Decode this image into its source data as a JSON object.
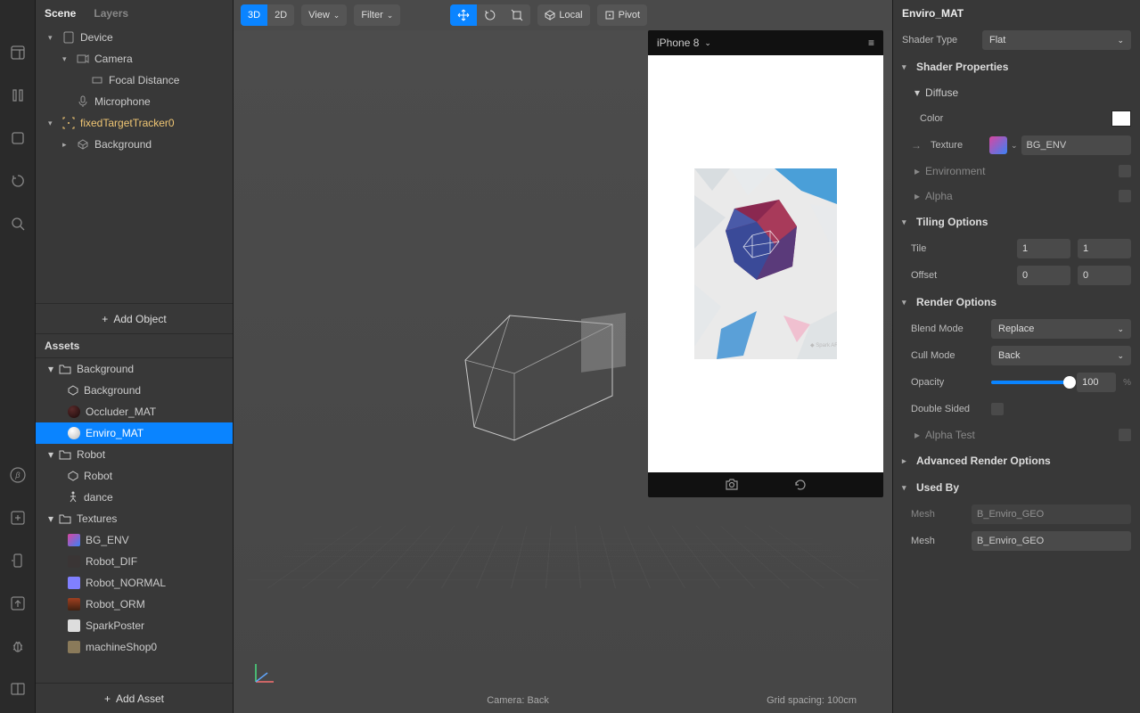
{
  "leftPanel": {
    "tabs": {
      "scene": "Scene",
      "layers": "Layers"
    },
    "scene": {
      "device": "Device",
      "camera": "Camera",
      "focalDistance": "Focal Distance",
      "microphone": "Microphone",
      "tracker": "fixedTargetTracker0",
      "background": "Background"
    },
    "addObject": "Add Object",
    "assetsHeader": "Assets",
    "assets": {
      "bgFolder": "Background",
      "bgMesh": "Background",
      "occluder": "Occluder_MAT",
      "enviro": "Enviro_MAT",
      "robotFolder": "Robot",
      "robotMesh": "Robot",
      "dance": "dance",
      "texFolder": "Textures",
      "bgEnv": "BG_ENV",
      "robotDif": "Robot_DIF",
      "robotNormal": "Robot_NORMAL",
      "robotOrm": "Robot_ORM",
      "sparkPoster": "SparkPoster",
      "machineShop": "machineShop0"
    },
    "addAsset": "Add Asset"
  },
  "toolbar": {
    "mode3d": "3D",
    "mode2d": "2D",
    "view": "View",
    "filter": "Filter",
    "local": "Local",
    "pivot": "Pivot"
  },
  "devicePreview": {
    "name": "iPhone 8"
  },
  "statusBar": {
    "camera": "Camera: Back",
    "grid": "Grid spacing: 100cm"
  },
  "inspector": {
    "title": "Enviro_MAT",
    "shaderTypeLabel": "Shader Type",
    "shaderType": "Flat",
    "shaderProperties": "Shader Properties",
    "diffuse": "Diffuse",
    "colorLabel": "Color",
    "textureLabel": "Texture",
    "textureName": "BG_ENV",
    "environment": "Environment",
    "alpha": "Alpha",
    "tilingOptions": "Tiling Options",
    "tileLabel": "Tile",
    "tileX": "1",
    "tileY": "1",
    "offsetLabel": "Offset",
    "offsetX": "0",
    "offsetY": "0",
    "renderOptions": "Render Options",
    "blendModeLabel": "Blend Mode",
    "blendMode": "Replace",
    "cullModeLabel": "Cull Mode",
    "cullMode": "Back",
    "opacityLabel": "Opacity",
    "opacity": "100",
    "doubleSided": "Double Sided",
    "alphaTest": "Alpha Test",
    "advancedRender": "Advanced Render Options",
    "usedBy": "Used By",
    "meshLabel": "Mesh",
    "mesh1": "B_Enviro_GEO",
    "mesh2": "B_Enviro_GEO"
  }
}
